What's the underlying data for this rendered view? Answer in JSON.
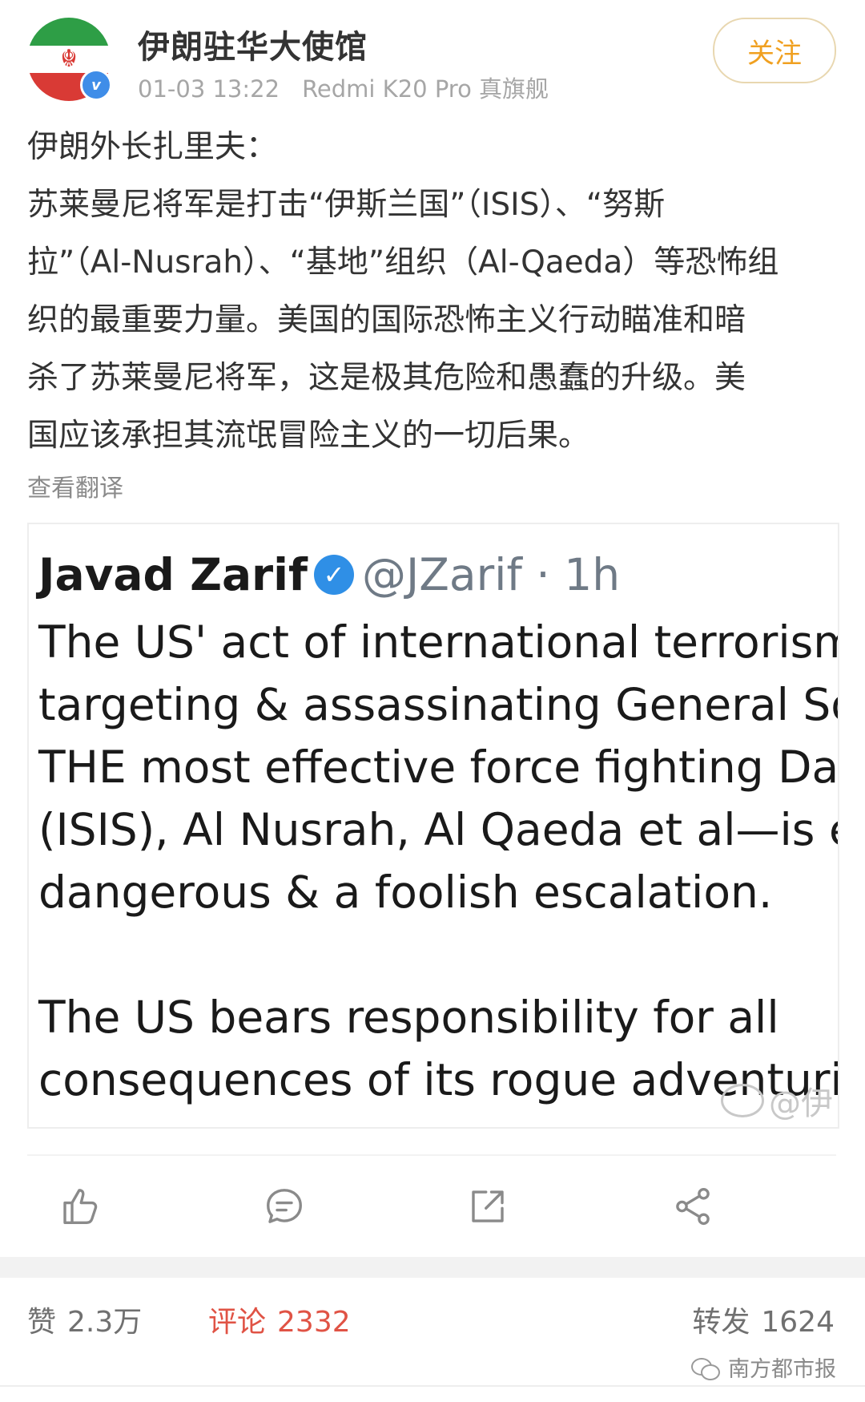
{
  "header": {
    "account_name": "伊朗驻华大使馆",
    "timestamp": "01-03 13:22",
    "device": "Redmi K20 Pro 真旗舰",
    "follow_label": "关注",
    "avatar_flag_colors": [
      "#2e9e46",
      "#ffffff",
      "#d93a35"
    ],
    "verified_icon": "verified-v-icon"
  },
  "post": {
    "lines": [
      "伊朗外长扎里夫：",
      "苏莱曼尼将军是打击“伊斯兰国”（ISIS）、“努斯",
      "拉”（Al-Nusrah）、“基地”组织（Al-Qaeda）等恐怖组",
      "织的最重要力量。美国的国际恐怖主义行动瞄准和暗",
      "杀了苏莱曼尼将军，这是极其危险和愚蠢的升级。美",
      "国应该承担其流氓冒险主义的一切后果。"
    ],
    "translate_label": "查看翻译"
  },
  "tweet_image": {
    "name": "Javad Zarif",
    "handle": "@JZarif · 1h",
    "lines": [
      "The US' act of international terrorism,",
      "targeting & assassinating General Sole",
      "THE most effective force fighting Daes",
      "(ISIS), Al Nusrah, Al Qaeda et al—is ext",
      "dangerous & a foolish escalation.",
      "",
      "The US bears responsibility for all",
      "consequences of its rogue adventurisı"
    ],
    "watermark": "@伊"
  },
  "actions": {
    "like_icon": "thumbs-up-icon",
    "comment_icon": "comment-icon",
    "repost_icon": "repost-icon",
    "share_icon": "share-icon"
  },
  "stats": {
    "like_label": "赞",
    "like_count": "2.3万",
    "comment_label": "评论",
    "comment_count": "2332",
    "repost_label": "转发",
    "repost_count": "1624"
  },
  "source": "南方都市报",
  "colors": {
    "accent_orange": "#f0a020",
    "comment_red": "#e05345",
    "verified_blue": "#3f8de8"
  }
}
